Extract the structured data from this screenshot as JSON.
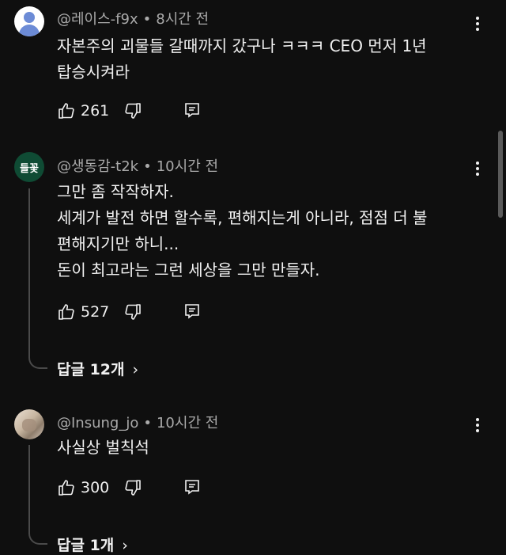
{
  "comments": [
    {
      "author": "@레이스-f9x",
      "time": "8시간 전",
      "avatar": "default-user-avatar",
      "text": "자본주의 괴물들 갈때까지 갔구나 ㅋㅋㅋ CEO 먼저 1년\n탑승시켜라",
      "likes": "261"
    },
    {
      "author": "@생동감-t2k",
      "time": "10시간 전",
      "avatar_text": "들꽃",
      "text": "그만 좀 작작하자.\n세계가 발전 하면 할수록, 편해지는게 아니라,  점점 더 불\n편해지기만 하니...\n돈이 최고라는 그런 세상을 그만 만들자.",
      "likes": "527",
      "replies": "답글 12개"
    },
    {
      "author": "@Insung_jo",
      "time": "10시간 전",
      "avatar": "photo-avatar",
      "text": "사실상 벌칙석",
      "likes": "300",
      "replies": "답글 1개"
    }
  ],
  "separator": "•",
  "chevron": "›",
  "icons": [
    "thumbs-up-icon",
    "thumbs-down-icon",
    "reply-icon",
    "more-vert-icon",
    "chevron-right-icon"
  ],
  "colors": {
    "background": "#0f0f0f",
    "text": "#f1f1f1",
    "secondary": "#aaaaaa",
    "avatar_green": "#0f4b34"
  }
}
